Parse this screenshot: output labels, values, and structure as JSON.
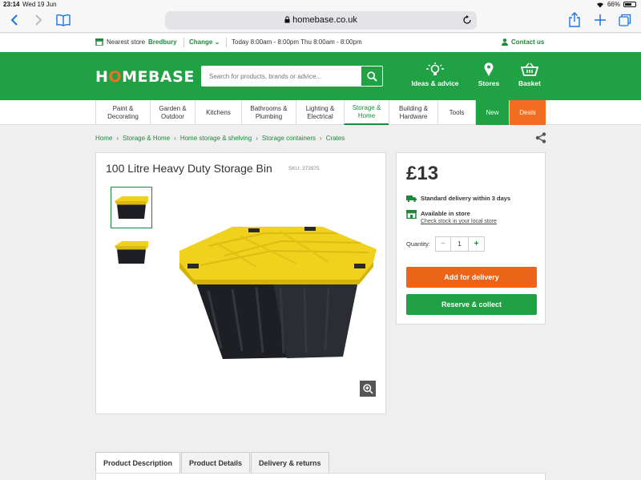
{
  "status": {
    "time": "23:14",
    "date": "Wed 19 Jun",
    "battery": "66%",
    "battery_level": 0.66
  },
  "browser": {
    "url": "homebase.co.uk"
  },
  "infobar": {
    "nearest_label": "Nearest store",
    "store_name": "Bredbury",
    "change_label": "Change",
    "hours": "Today 8:00am - 8:00pm  Thu 8:00am - 8:00pm",
    "contact_label": "Contact us"
  },
  "header": {
    "logo_pre": "H",
    "logo_o": "O",
    "logo_post": "MEBASE",
    "search_placeholder": "Search for products, brands or advice...",
    "nav": [
      {
        "label": "Ideas & advice",
        "icon": "lightbulb-icon"
      },
      {
        "label": "Stores",
        "icon": "location-pin-icon"
      },
      {
        "label": "Basket",
        "icon": "basket-icon"
      }
    ]
  },
  "categories": [
    {
      "line1": "Paint &",
      "line2": "Decorating"
    },
    {
      "line1": "Garden &",
      "line2": "Outdoor"
    },
    {
      "line1": "Kitchens",
      "line2": ""
    },
    {
      "line1": "Bathrooms &",
      "line2": "Plumbing"
    },
    {
      "line1": "Lighting &",
      "line2": "Electrical"
    },
    {
      "line1": "Storage &",
      "line2": "Home"
    },
    {
      "line1": "Building &",
      "line2": "Hardware"
    },
    {
      "line1": "Tools",
      "line2": ""
    },
    {
      "line1": "New",
      "line2": ""
    },
    {
      "line1": "Deals",
      "line2": ""
    }
  ],
  "breadcrumb": [
    "Home",
    "Storage & Home",
    "Home storage & shelving",
    "Storage containers",
    "Crates"
  ],
  "product": {
    "title": "100 Litre Heavy Duty Storage Bin",
    "sku": "SKU: 373975",
    "price": "£13",
    "delivery": "Standard delivery within 3 days",
    "available": "Available in store",
    "check_stock": "Check stock in your local store",
    "quantity_label": "Quantity:",
    "quantity_value": "1",
    "minus": "−",
    "plus": "+",
    "add_delivery": "Add for delivery",
    "reserve": "Reserve & collect"
  },
  "tabs": [
    "Product Description",
    "Product Details",
    "Delivery & returns"
  ],
  "colors": {
    "brand_green": "#1fa144",
    "accent_orange": "#ec6417",
    "bin_yellow": "#f0d11e",
    "bin_black": "#1d1f24"
  }
}
